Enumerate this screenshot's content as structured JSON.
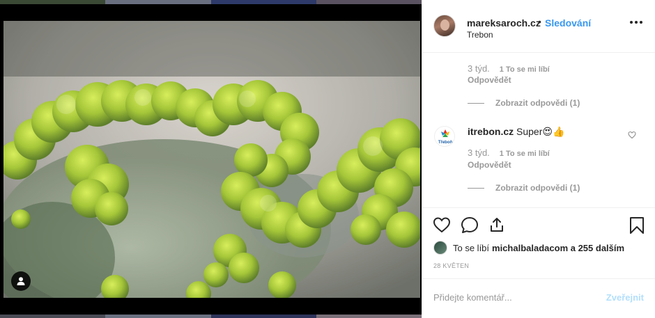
{
  "post": {
    "username": "mareksaroch.cz",
    "separator": "•",
    "follow_label": "Sledování",
    "location": "Trebon",
    "likes_text": "To se líbí",
    "likes_users": "michalbaladacom a 255 dalším",
    "date": "28 KVĚTEN",
    "comment_placeholder": "Přidejte komentář...",
    "post_label": "Zveřejnit"
  },
  "comments": [
    {
      "time": "3 týd.",
      "likes": "1 To se mi líbí",
      "reply_label": "Odpovědět",
      "view_replies": "Zobrazit odpovědi (1)"
    },
    {
      "username": "itrebon.cz",
      "text": "Super😍👍",
      "time": "3 týd.",
      "likes": "1 To se mi líbí",
      "reply_label": "Odpovědět",
      "view_replies": "Zobrazit odpovědi (1)",
      "avatar_text": "Třeboň"
    }
  ],
  "icons": {
    "like": "heart-icon",
    "comment": "comment-icon",
    "share": "share-icon",
    "save": "bookmark-icon",
    "more": "more-icon",
    "user_tag": "user-icon"
  },
  "colors": {
    "link_blue": "#3897f0",
    "muted": "#999999",
    "post_disabled": "#b2dffc",
    "text": "#262626"
  }
}
